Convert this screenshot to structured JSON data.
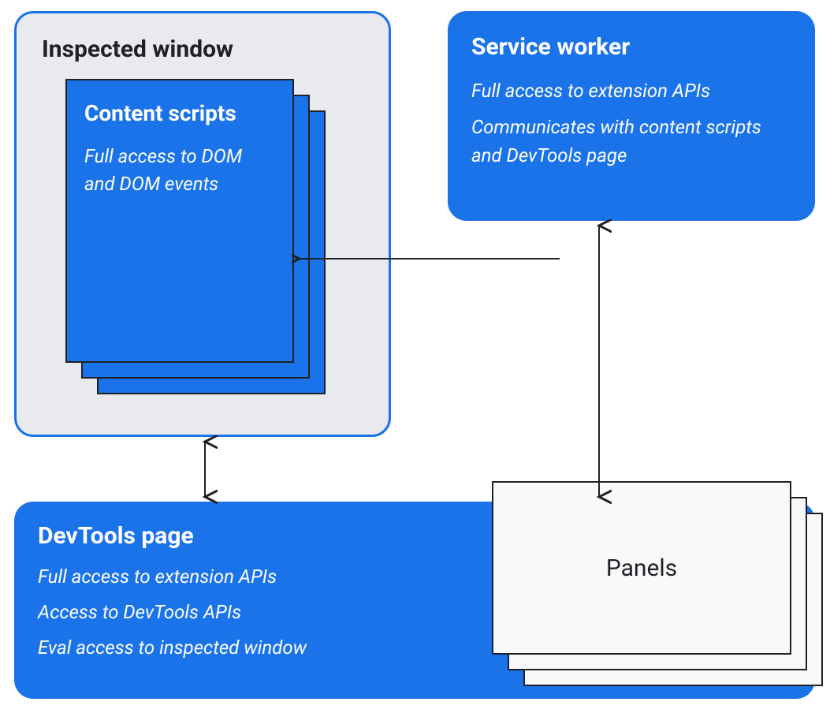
{
  "inspectedWindow": {
    "title": "Inspected window",
    "contentScripts": {
      "title": "Content scripts",
      "description": "Full access to DOM and DOM events"
    }
  },
  "serviceWorker": {
    "title": "Service worker",
    "line1": "Full access to extension APIs",
    "line2": "Communicates with content scripts and DevTools page"
  },
  "devtoolsPage": {
    "title": "DevTools page",
    "line1": "Full access to extension APIs",
    "line2": "Access to DevTools APIs",
    "line3": "Eval access to inspected window",
    "panelsLabel": "Panels"
  }
}
